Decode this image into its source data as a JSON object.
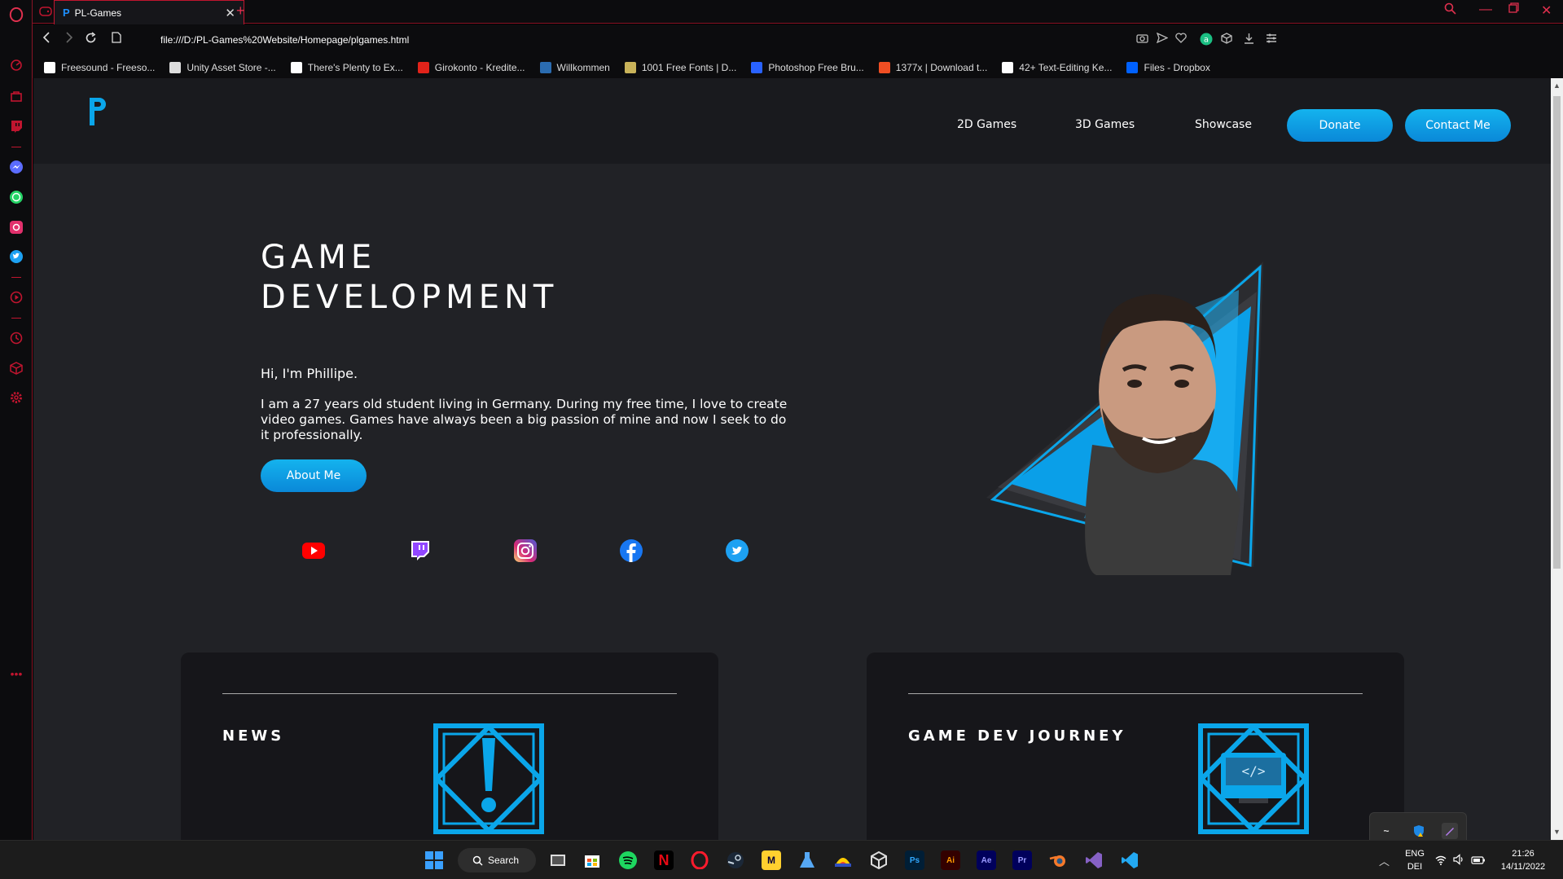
{
  "browser": {
    "tab_title": "PL-Games",
    "tab_favicon": "P",
    "url": "file:///D:/PL-Games%20Website/Homepage/plgames.html",
    "bookmarks": [
      {
        "label": "Freesound - Freeso...",
        "icon": "waveform-icon",
        "color": "#ffffff"
      },
      {
        "label": "Unity Asset Store -...",
        "icon": "unity-icon",
        "color": "#dddddd"
      },
      {
        "label": "There's Plenty to Ex...",
        "icon": "document-icon",
        "color": "#ffffff"
      },
      {
        "label": "Girokonto - Kredite...",
        "icon": "bank-icon",
        "color": "#e2231a"
      },
      {
        "label": "Willkommen",
        "icon": "globe-icon",
        "color": "#2b6cb0"
      },
      {
        "label": "1001 Free Fonts | D...",
        "icon": "fonts-icon",
        "color": "#c9b35a"
      },
      {
        "label": "Photoshop Free Bru...",
        "icon": "brush-b-icon",
        "color": "#2962ff"
      },
      {
        "label": "1377x | Download t...",
        "icon": "x-icon",
        "color": "#f04e23"
      },
      {
        "label": "42+ Text-Editing Ke...",
        "icon": "htg-icon",
        "color": "#ffffff"
      },
      {
        "label": "Files - Dropbox",
        "icon": "dropbox-icon",
        "color": "#0061ff"
      }
    ]
  },
  "site": {
    "nav": {
      "links": [
        "2D Games",
        "3D Games",
        "Showcase"
      ],
      "donate": "Donate",
      "contact": "Contact Me"
    },
    "hero": {
      "title_line1": "GAME",
      "title_line2": "DEVELOPMENT",
      "greeting": "Hi, I'm Phillipe.",
      "bio": "I am a 27 years old student living in Germany. During my free time, I love to create video games. Games have always been a big passion of mine and now I seek to do it professionally.",
      "about_button": "About Me"
    },
    "socials": [
      "youtube-icon",
      "twitch-icon",
      "instagram-icon",
      "facebook-icon",
      "twitter-icon"
    ],
    "cards": [
      {
        "title": "NEWS",
        "icon": "exclamation-icon"
      },
      {
        "title": "GAME DEV JOURNEY",
        "icon": "code-monitor-icon"
      }
    ]
  },
  "taskbar": {
    "search_label": "Search",
    "language_top": "ENG",
    "language_bottom": "DEI",
    "time": "21:26",
    "date": "14/11/2022"
  },
  "colors": {
    "accent": "#0aa6ea",
    "opera_red": "#c0152f",
    "page_bg": "#212226",
    "header_bg": "#191a1e"
  }
}
